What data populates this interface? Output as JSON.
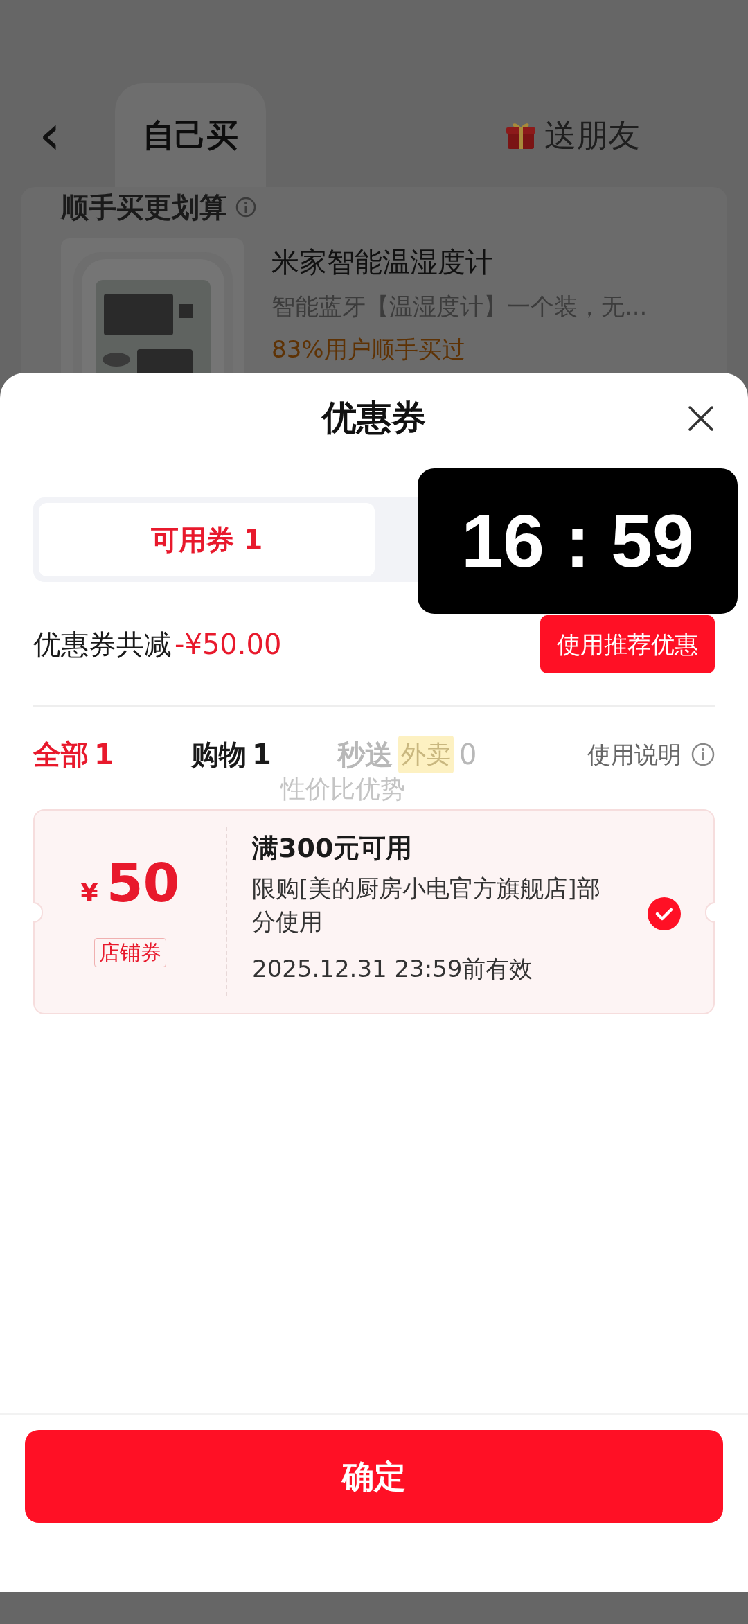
{
  "header": {
    "back": "‹",
    "tabs": [
      {
        "label": "自己买",
        "selected": true,
        "kind": "plain"
      },
      {
        "label": "送朋友",
        "selected": false,
        "kind": "gift"
      }
    ]
  },
  "background_card": {
    "title": "顺手买更划算",
    "product": {
      "kind": "picture",
      "title": "米家智能温湿度计",
      "subtitle": "智能蓝牙【温湿度计】一个装，无...",
      "note": "83%用户顺手买过"
    }
  },
  "sheet": {
    "title": "优惠券",
    "tabs": [
      {
        "label": "可用券 1",
        "selected": true
      }
    ],
    "timer": "16 : 59",
    "summary": {
      "label": "优惠券共减",
      "amount": "-¥50.00"
    },
    "recommend_button": "使用推荐优惠",
    "filters": [
      {
        "label": "全部",
        "count": "1",
        "selected": true,
        "disabled": false
      },
      {
        "label": "购物",
        "count": "1",
        "selected": false,
        "disabled": false
      },
      {
        "label": "秒送",
        "tag": "外卖",
        "count": "0",
        "selected": false,
        "disabled": true
      }
    ],
    "help": "使用说明",
    "overlay_text": "性价比优势",
    "coupons": [
      {
        "currency": "¥",
        "value": "50",
        "type": "店铺券",
        "condition": "满300元可用",
        "scope": "限购[美的厨房小电官方旗舰店]部分使用",
        "validity": "2025.12.31 23:59前有效",
        "selected": true
      }
    ],
    "confirm_button": "确定"
  }
}
